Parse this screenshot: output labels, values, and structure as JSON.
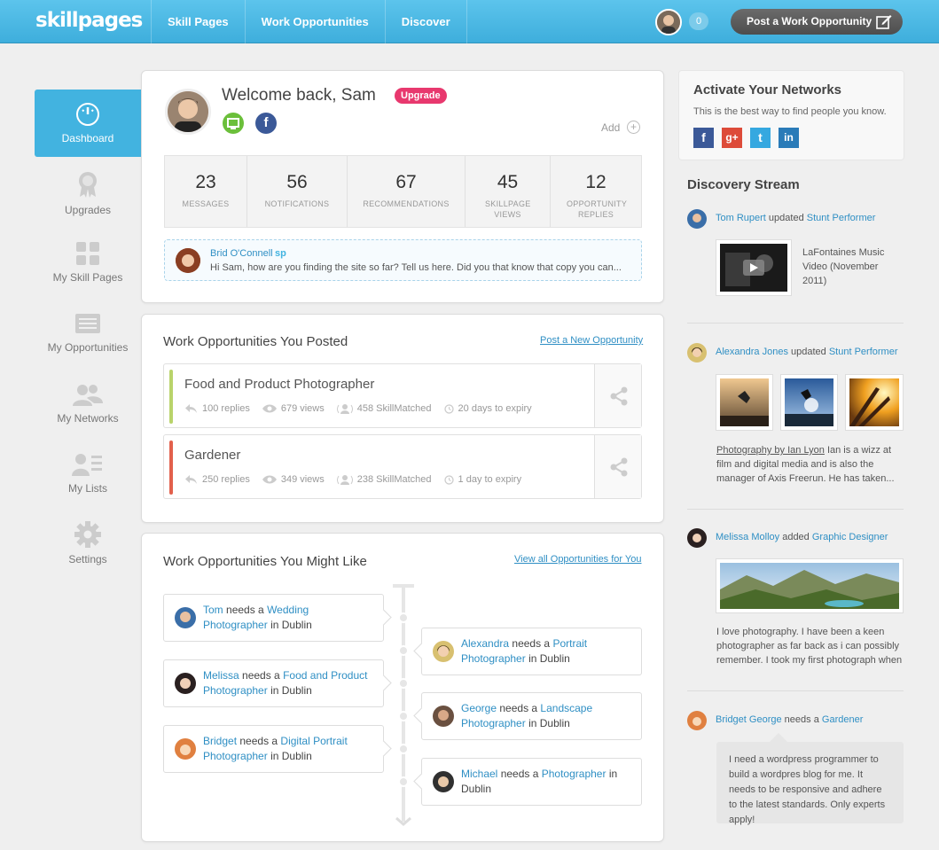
{
  "header": {
    "logo": "skillpages",
    "nav": [
      "Skill Pages",
      "Work Opportunities",
      "Discover"
    ],
    "notification_count": "0",
    "post_button": "Post a Work Opportunity"
  },
  "sidebar": {
    "items": [
      {
        "label": "Dashboard",
        "icon": "dashboard-icon"
      },
      {
        "label": "Upgrades",
        "icon": "award-icon"
      },
      {
        "label": "My Skill Pages",
        "icon": "grid-icon"
      },
      {
        "label": "My Opportunities",
        "icon": "list-icon"
      },
      {
        "label": "My Networks",
        "icon": "people-icon"
      },
      {
        "label": "My Lists",
        "icon": "user-list-icon"
      },
      {
        "label": "Settings",
        "icon": "gear-icon"
      }
    ]
  },
  "welcome": {
    "title": "Welcome back, Sam",
    "badge": "Upgrade",
    "add_label": "Add",
    "add_icon": "+",
    "facebook_letter": "f",
    "stats": [
      {
        "num": "23",
        "label": "MESSAGES"
      },
      {
        "num": "56",
        "label": "NOTIFICATIONS"
      },
      {
        "num": "67",
        "label": "RECOMMENDATIONS"
      },
      {
        "num": "45",
        "label": "SKILLPAGE VIEWS"
      },
      {
        "num": "12",
        "label": "OPPORTUNITY REPLIES"
      }
    ],
    "message": {
      "name": "Brid O'Connell",
      "tag": "sp",
      "text": "Hi Sam, how are you finding the site so far? Tell us here. Did you that know that copy you can..."
    }
  },
  "posted": {
    "title": "Work Opportunities You Posted",
    "link": "Post a New Opportunity",
    "jobs": [
      {
        "title": "Food and Product Photographer",
        "replies": "100 replies",
        "views": "679 views",
        "matched": "458 SkillMatched",
        "expiry": "20 days to expiry",
        "color": "#b9d36b"
      },
      {
        "title": "Gardener",
        "replies": "250 replies",
        "views": "349 views",
        "matched": "238 SkillMatched",
        "expiry": "1 day to expiry",
        "color": "#e2604c"
      }
    ]
  },
  "might_like": {
    "title": "Work Opportunities You Might Like",
    "link": "View all Opportunities for You",
    "needs": "needs a",
    "in": "in",
    "items": [
      {
        "name": "Tom",
        "role": "Wedding Photographer",
        "place": "Dublin"
      },
      {
        "name": "Alexandra",
        "role": "Portrait Photographer",
        "place": "Dublin"
      },
      {
        "name": "Melissa",
        "role": "Food and Product Photographer",
        "place": "Dublin"
      },
      {
        "name": "George",
        "role": "Landscape Photographer",
        "place": "Dublin"
      },
      {
        "name": "Bridget",
        "role": "Digital Portrait Photographer",
        "place": "Dublin"
      },
      {
        "name": "Michael",
        "role": "Photographer",
        "place": "Dublin"
      }
    ]
  },
  "networks": {
    "title": "Activate Your Networks",
    "subtitle": "This is the best way to find people you know.",
    "buttons": [
      "f",
      "g+",
      "t",
      "in"
    ]
  },
  "discovery": {
    "title": "Discovery Stream",
    "entries": [
      {
        "name": "Tom Rupert",
        "action": "updated",
        "target": "Stunt Performer",
        "text": "LaFontaines Music Video (November 2011)"
      },
      {
        "name": "Alexandra Jones",
        "action": "updated",
        "target": "Stunt Performer",
        "link_text": "Photography by Ian Lyon",
        "text": " Ian is a wizz at film and digital media and is also the manager of Axis Freerun. He has taken..."
      },
      {
        "name": "Melissa Molloy",
        "action": "added",
        "target": "Graphic Designer",
        "text": "I love photography. I have been a keen photographer as far back as i can possibly remember. I took my first photograph when"
      },
      {
        "name": "Bridget George",
        "action": "needs a",
        "target": "Gardener",
        "text": "I need a wordpress programmer to build a wordpres blog for me. It needs to be responsive and adhere to the latest standards. Only experts apply!"
      }
    ]
  }
}
